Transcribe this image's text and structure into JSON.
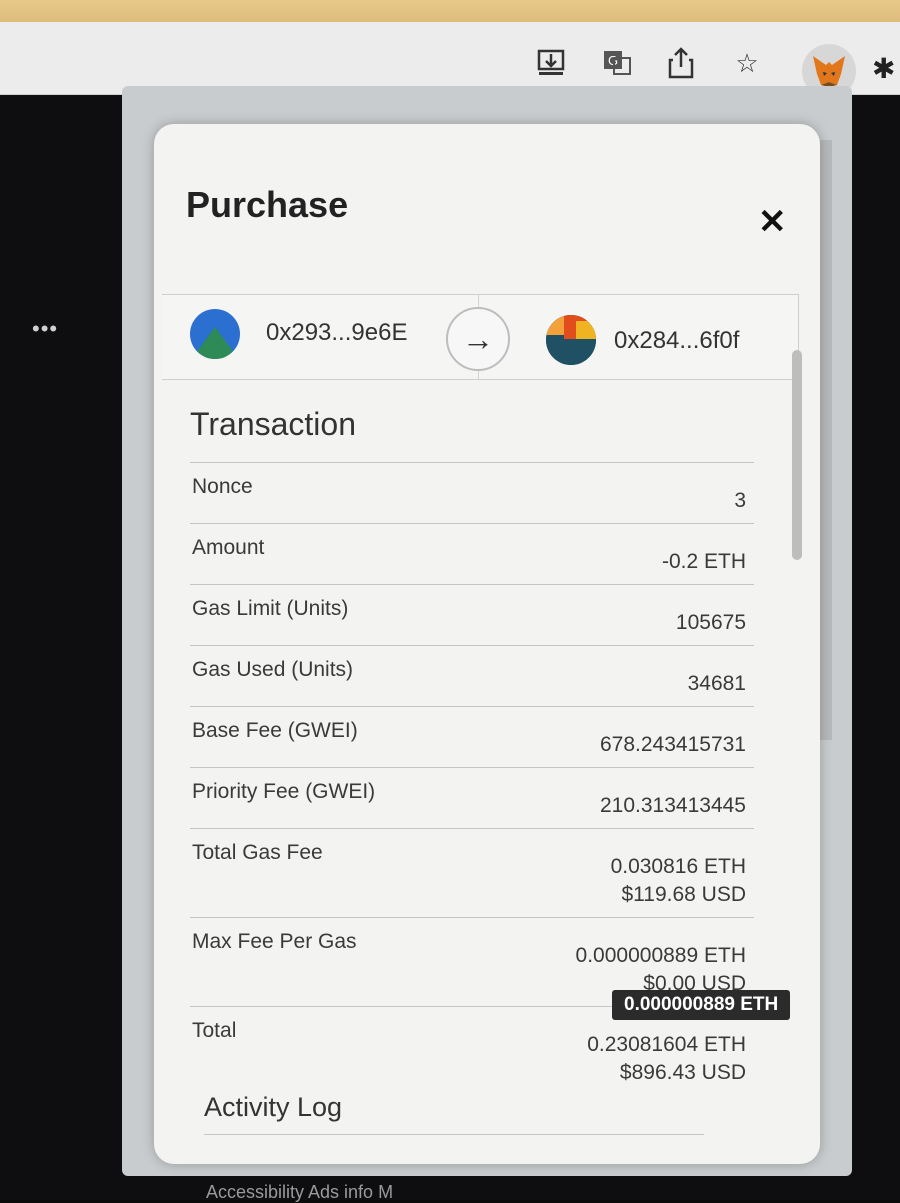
{
  "browser": {
    "toolbar_icons": [
      "install-icon",
      "translate-icon",
      "share-icon",
      "bookmark-star-icon",
      "metamask-fox-icon",
      "extensions-puzzle-icon"
    ],
    "footer_text": "Accessibility   Ads info   M"
  },
  "modal": {
    "title": "Purchase",
    "from_address": "0x293...9e6E",
    "to_address": "0x284...6f0f",
    "section_title": "Transaction",
    "rows": [
      {
        "label": "Nonce",
        "value": "3"
      },
      {
        "label": "Amount",
        "value": "-0.2 ETH"
      },
      {
        "label": "Gas Limit (Units)",
        "value": "105675"
      },
      {
        "label": "Gas Used (Units)",
        "value": "34681"
      },
      {
        "label": "Base Fee (GWEI)",
        "value": "678.243415731"
      },
      {
        "label": "Priority Fee (GWEI)",
        "value": "210.313413445"
      },
      {
        "label": "Total Gas Fee",
        "value": "0.030816 ETH",
        "value2": "$119.68 USD"
      },
      {
        "label": "Max Fee Per Gas",
        "value": "0.000000889 ETH",
        "value2": "$0.00 USD"
      },
      {
        "label": "Total",
        "value": "0.23081604 ETH",
        "value2": "$896.43 USD"
      }
    ],
    "tooltip": "0.000000889 ETH",
    "activity_log_title": "Activity Log"
  },
  "colors": {
    "modal_bg": "#f3f3f2",
    "text": "#333333",
    "tooltip_bg": "#2b2b2b"
  }
}
